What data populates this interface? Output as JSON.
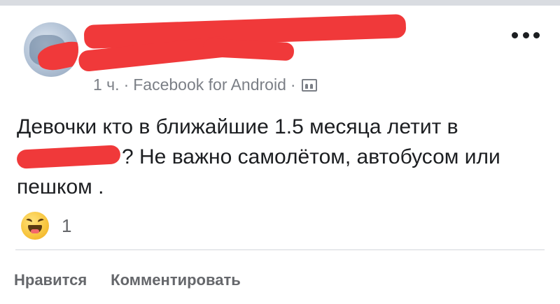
{
  "post": {
    "author": "",
    "meta": {
      "time": "1 ч.",
      "separator": "·",
      "source": "Facebook for Android",
      "audience_icon": "friends-icon"
    },
    "text": {
      "line1": "Девочки кто в ближайшие 1.5 месяца летит в",
      "line2_after_redaction": "? Не важно самолётом, автобусом или",
      "line3": "пешком ."
    },
    "reactions": {
      "icon": "haha-icon",
      "count": "1"
    }
  },
  "actions": {
    "like": "Нравится",
    "comment": "Комментировать"
  },
  "colors": {
    "redaction": "#f0393a",
    "text": "#1c1e21",
    "meta": "#7b7f86",
    "actions": "#65676b"
  }
}
